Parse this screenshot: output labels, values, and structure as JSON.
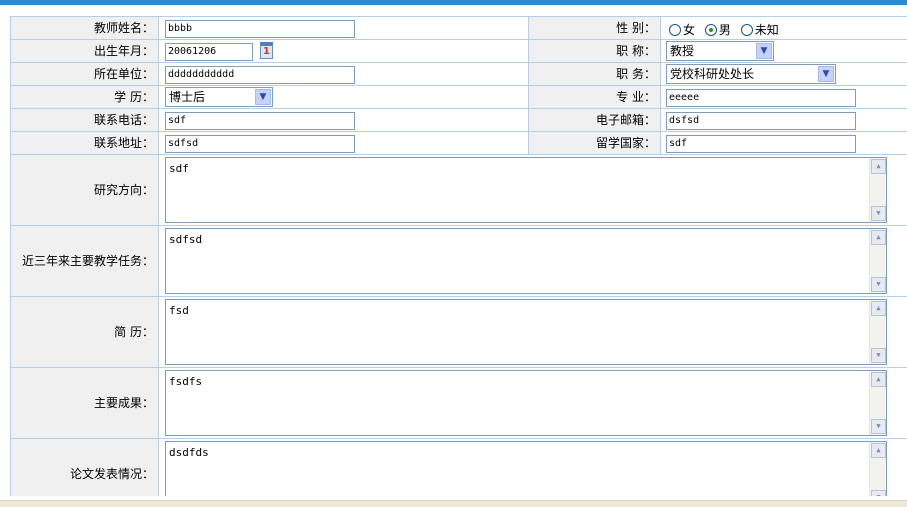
{
  "labels": {
    "name": "教师姓名：",
    "gender": "性    别：",
    "birth": "出生年月：",
    "title": "职  称：",
    "unit": "所在单位：",
    "position": "职    务：",
    "degree": "学  历：",
    "major": "专  业：",
    "phone": "联系电话：",
    "email": "电子邮箱：",
    "address": "联系地址：",
    "country": "留学国家：",
    "research": "研究方向：",
    "teaching": "近三年来主要教学任务：",
    "resume": "简  历：",
    "achievements": "主要成果：",
    "papers": "论文发表情况："
  },
  "fields": {
    "name": "bbbb",
    "birth": "20061206",
    "unit": "ddddddddddd",
    "degree": "博士后",
    "phone": "sdf",
    "address": "sdfsd",
    "title": "教授",
    "position": "党校科研处处长",
    "major": "eeeee",
    "email": "dsfsd",
    "country": "sdf",
    "research": "sdf",
    "teaching": "sdfsd",
    "resume": "fsd",
    "achievements": "fsdfs",
    "papers": "dsdfds"
  },
  "gender": {
    "options": [
      "女",
      "男",
      "未知"
    ],
    "selected": "男"
  },
  "calendar_icon_text": "1",
  "icons": {
    "select_arrow": "chevron-down-icon",
    "calendar": "calendar-icon",
    "scroll_up": "scroll-up-icon",
    "scroll_down": "scroll-down-icon"
  },
  "colors": {
    "accent_bar": "#2a8bd0",
    "grid": "#b7cfe6",
    "label_bg": "#f0f0f0",
    "input_border": "#7f9db9"
  }
}
